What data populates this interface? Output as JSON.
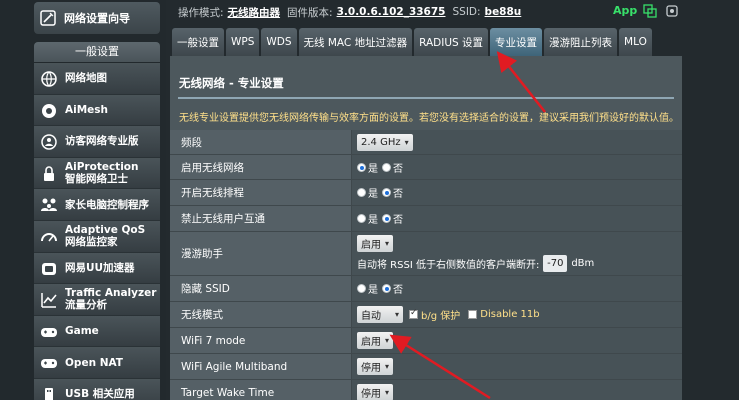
{
  "sidebar": {
    "top_item": "网络设置向导",
    "section_header": "一般设置",
    "items": [
      {
        "label": "网络地图",
        "icon": "globe-icon"
      },
      {
        "label": "AiMesh",
        "icon": "mesh-icon"
      },
      {
        "label": "访客网络专业版",
        "icon": "guest-network-icon"
      },
      {
        "label1": "AiProtection",
        "label2": "智能网络卫士",
        "icon": "lock-icon"
      },
      {
        "label": "家长电脑控制程序",
        "icon": "family-icon"
      },
      {
        "label1": "Adaptive QoS",
        "label2": "网络监控家",
        "icon": "qos-icon"
      },
      {
        "label": "网易UU加速器",
        "icon": "uu-accelerator-icon"
      },
      {
        "label1": "Traffic Analyzer",
        "label2": "流量分析",
        "icon": "chart-icon"
      },
      {
        "label": "Game",
        "icon": "gamepad-icon"
      },
      {
        "label": "Open NAT",
        "icon": "gamepad-nat-icon"
      },
      {
        "label": "USB 相关应用",
        "icon": "usb-icon"
      }
    ]
  },
  "topbar": {
    "mode_label": "操作模式:",
    "mode_value": "无线路由器",
    "firmware_label": "固件版本:",
    "firmware_value": "3.0.0.6.102_33675",
    "ssid_label": "SSID:",
    "ssid_value": "be88u",
    "app_label": "App"
  },
  "tabs": [
    "一般设置",
    "WPS",
    "WDS",
    "无线 MAC 地址过滤器",
    "RADIUS 设置",
    "专业设置",
    "漫游阻止列表",
    "MLO"
  ],
  "active_tab": "专业设置",
  "main": {
    "title": "无线网络 - 专业设置",
    "description": "无线专业设置提供您无线网络传输与效率方面的设置。若您没有选择适合的设置，建议采用我们预设好的默认值。"
  },
  "settings": {
    "band": {
      "label": "频段",
      "value": "2.4 GHz"
    },
    "enable_radio": {
      "label": "启用无线网络",
      "yes": "是",
      "no": "否"
    },
    "enable_schedule": {
      "label": "开启无线排程",
      "yes": "是",
      "no": "否"
    },
    "ap_isolation": {
      "label": "禁止无线用户互通",
      "yes": "是",
      "no": "否"
    },
    "roaming": {
      "label": "漫游助手",
      "value": "启用",
      "text_before": "自动将 RSSI 低于右侧数值的客户端断开:",
      "rssi_value": "-70",
      "unit": "dBm"
    },
    "hide_ssid": {
      "label": "隐藏 SSID",
      "yes": "是",
      "no": "否"
    },
    "wireless_mode": {
      "label": "无线模式",
      "value": "自动",
      "bg_protection": "b/g 保护",
      "disable_11b": "Disable 11b"
    },
    "wifi7": {
      "label": "WiFi 7 mode",
      "value": "启用"
    },
    "agile": {
      "label": "WiFi Agile Multiband",
      "value": "停用"
    },
    "twt": {
      "label": "Target Wake Time",
      "value": "停用"
    }
  }
}
